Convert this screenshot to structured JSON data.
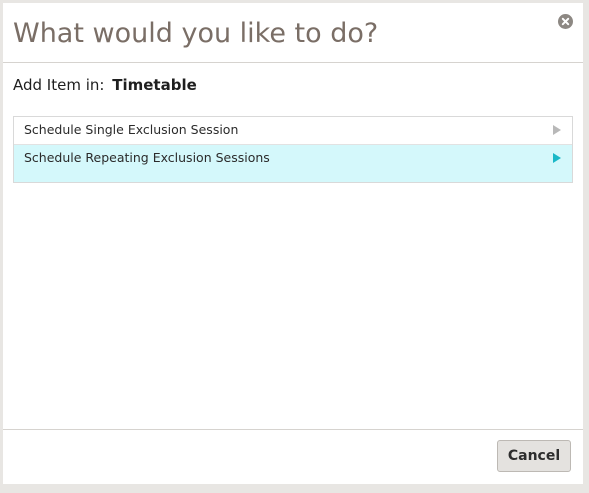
{
  "dialog": {
    "title": "What would you like to do?",
    "close_icon": "close-circle-icon"
  },
  "context": {
    "label": "Add Item in:",
    "value": "Timetable"
  },
  "options": [
    {
      "label": "Schedule Single Exclusion Session",
      "icon": "chevron-right-icon",
      "selected": false
    },
    {
      "label": "Schedule Repeating Exclusion Sessions",
      "icon": "chevron-right-icon",
      "selected": true
    }
  ],
  "footer": {
    "cancel_label": "Cancel"
  },
  "colors": {
    "title": "#7a6e66",
    "selected_row": "#d4f8fb",
    "selected_arrow": "#1ab8c7",
    "default_arrow": "#b8b8b8",
    "page_background": "#e8e6e3"
  }
}
